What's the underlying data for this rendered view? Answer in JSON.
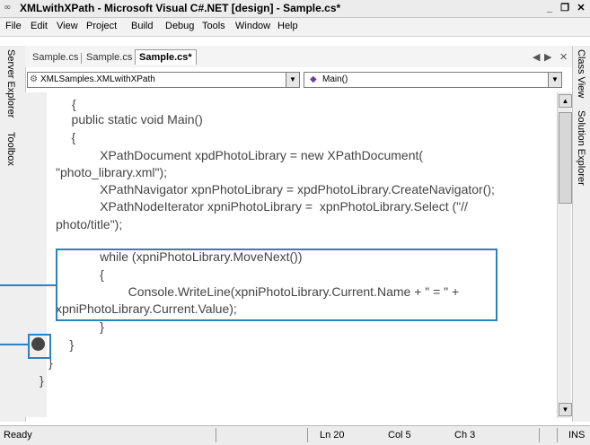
{
  "window": {
    "title": "XMLwithXPath - Microsoft Visual C#.NET [design] - Sample.cs*",
    "controls": [
      "_",
      "❐",
      "✕"
    ]
  },
  "menu": [
    "File",
    "Edit",
    "View",
    "Project",
    "Build",
    "Debug",
    "Tools",
    "Window",
    "Help"
  ],
  "left_panes": [
    "Server Explorer",
    "Toolbox"
  ],
  "right_panes": [
    "Class View",
    "Solution Explorer"
  ],
  "tabs": [
    {
      "label": "Sample.cs",
      "active": false
    },
    {
      "label": "Sample.cs",
      "active": false
    },
    {
      "label": "Sample.cs*",
      "active": true
    }
  ],
  "tab_nav": [
    "◀",
    "▶",
    "✕"
  ],
  "class_dropdown": {
    "icon": "⚙",
    "value": "XMLSamples.XMLwithXPath"
  },
  "method_dropdown": {
    "icon": "◆",
    "value": "Main()"
  },
  "code_lines": [
    "{",
    "    public static void Main()",
    "    {",
    "        XPathDocument xpdPhotoLibrary = new XPathDocument(",
    "\"photo_library.xml\");",
    "        XPathNavigator xpnPhotoLibrary = xpdPhotoLibrary.CreateNavigator();",
    "        XPathNodeIterator xpniPhotoLibrary =  xpnPhotoLibrary.Select (\"//",
    "photo/title\");",
    "",
    "        while (xpniPhotoLibrary.MoveNext())",
    "        {",
    "            Console.WriteLine(xpniPhotoLibrary.Current.Name + \" = \" +",
    "xpniPhotoLibrary.Current.Value);",
    "        }",
    "    }",
    "}",
    "}"
  ],
  "status": {
    "text": "Ready",
    "line": "Ln 20",
    "col": "Col 5",
    "ch": "Ch 3",
    "mode": "INS"
  },
  "colors": {
    "callout": "#2b82c2",
    "breakpoint": "#444444"
  }
}
